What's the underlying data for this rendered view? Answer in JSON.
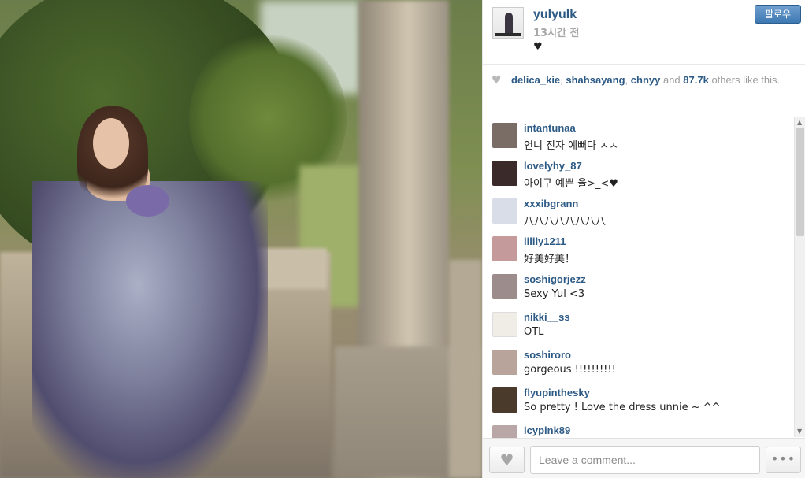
{
  "post": {
    "username": "yulyulk",
    "time": "13시간 전",
    "caption": "♥",
    "follow_label": "팔로우"
  },
  "likes": {
    "user1": "delica_kie",
    "sep1": ", ",
    "user2": "shahsayang",
    "sep2": ", ",
    "user3": "chnyy",
    "rest1": " and ",
    "count": "87.7k",
    "rest2": " others like this."
  },
  "comments": [
    {
      "user": "intantunaa",
      "text": "언니 진자 예뻐다 ㅅㅅ",
      "avatar_color": "#7a6d66"
    },
    {
      "user": "lovelyhy_87",
      "text": "아이구 예쁜 율>_<♥",
      "avatar_color": "#3b2a2a"
    },
    {
      "user": "xxxibgrann",
      "text": "八八八八八八八八",
      "avatar_color": "#d8dde8"
    },
    {
      "user": "lilily1211",
      "text": "好美好美！",
      "avatar_color": "#c59a9a"
    },
    {
      "user": "soshigorjezz",
      "text": "Sexy Yul <3",
      "avatar_color": "#9c8c8c"
    },
    {
      "user": "nikki__ss",
      "text": "OTL",
      "avatar_color": "#f0ece6"
    },
    {
      "user": "soshiroro",
      "text": "gorgeous !!!!!!!!!!",
      "avatar_color": "#b8a49a"
    },
    {
      "user": "flyupinthesky",
      "text": "So pretty ! Love the dress unnie ~ ^^",
      "avatar_color": "#4a3a2c"
    },
    {
      "user": "icypink89",
      "text": "",
      "avatar_color": "#b9a6a6"
    }
  ],
  "footer": {
    "comment_placeholder": "Leave a comment...",
    "like_icon": "heart-icon",
    "more_icon": "ellipsis-icon"
  },
  "colors": {
    "username_blue": "#2c5a85",
    "follow_button": "#3e78b2"
  }
}
